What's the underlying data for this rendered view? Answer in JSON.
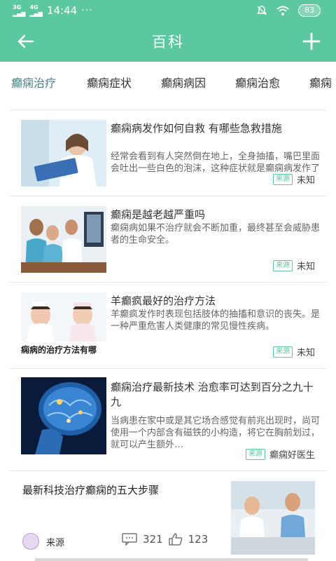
{
  "status": {
    "signal1": "3G",
    "signal2": "4G",
    "time": "14:44",
    "dots": "···",
    "battery": "83"
  },
  "appbar": {
    "title": "百科",
    "back_icon": "arrow-left-icon",
    "add_icon": "plus-icon"
  },
  "tabs": [
    {
      "label": "癫痫治疗",
      "active": true
    },
    {
      "label": "癫痫症状",
      "active": false
    },
    {
      "label": "癫痫病因",
      "active": false
    },
    {
      "label": "癫痫治愈",
      "active": false
    },
    {
      "label": "癫痫",
      "active": false
    }
  ],
  "articles": [
    {
      "title": "癫痫病发作如何自救 有哪些急救措施",
      "desc": "经常会看到有人突然倒在地上，全身抽搐，嘴巴里面会吐出一些白色的泡沫，这种症状就是癫痫病发作了",
      "tag": "来源",
      "source": "未知"
    },
    {
      "title": "癫痫是越老越严重吗",
      "desc": "癫痫病如果不治疗就会不断加重，最终甚至会威胁患者的生命安全。",
      "tag": "来源",
      "source": "未知"
    },
    {
      "title": "羊癫疯最好的治疗方法",
      "desc": "羊癫疯发作时表现包括肢体的抽搐和意识的丧失。是一种严重危害人类健康的常见慢性疾病。",
      "tag": "来源",
      "source": "未知",
      "thumb_caption": "痫病的治疗方法有哪"
    },
    {
      "title": "癫痫治疗最新技术 治愈率可达到百分之九十九",
      "desc": "当病患在家中或是其它场合感觉有前兆出现时，尚可使用一个内部含有磁铁的小构造，将它在胸前划过，就可以产生额外…",
      "tag": "来源",
      "source": "癫痫好医生"
    }
  ],
  "bottom_article": {
    "title": "最新科技治疗癫痫的五大步骤",
    "source": "来源",
    "comments": "321",
    "likes": "123"
  },
  "colors": {
    "accent": "#5cc8a0",
    "active_tab": "#4a7f8a"
  }
}
